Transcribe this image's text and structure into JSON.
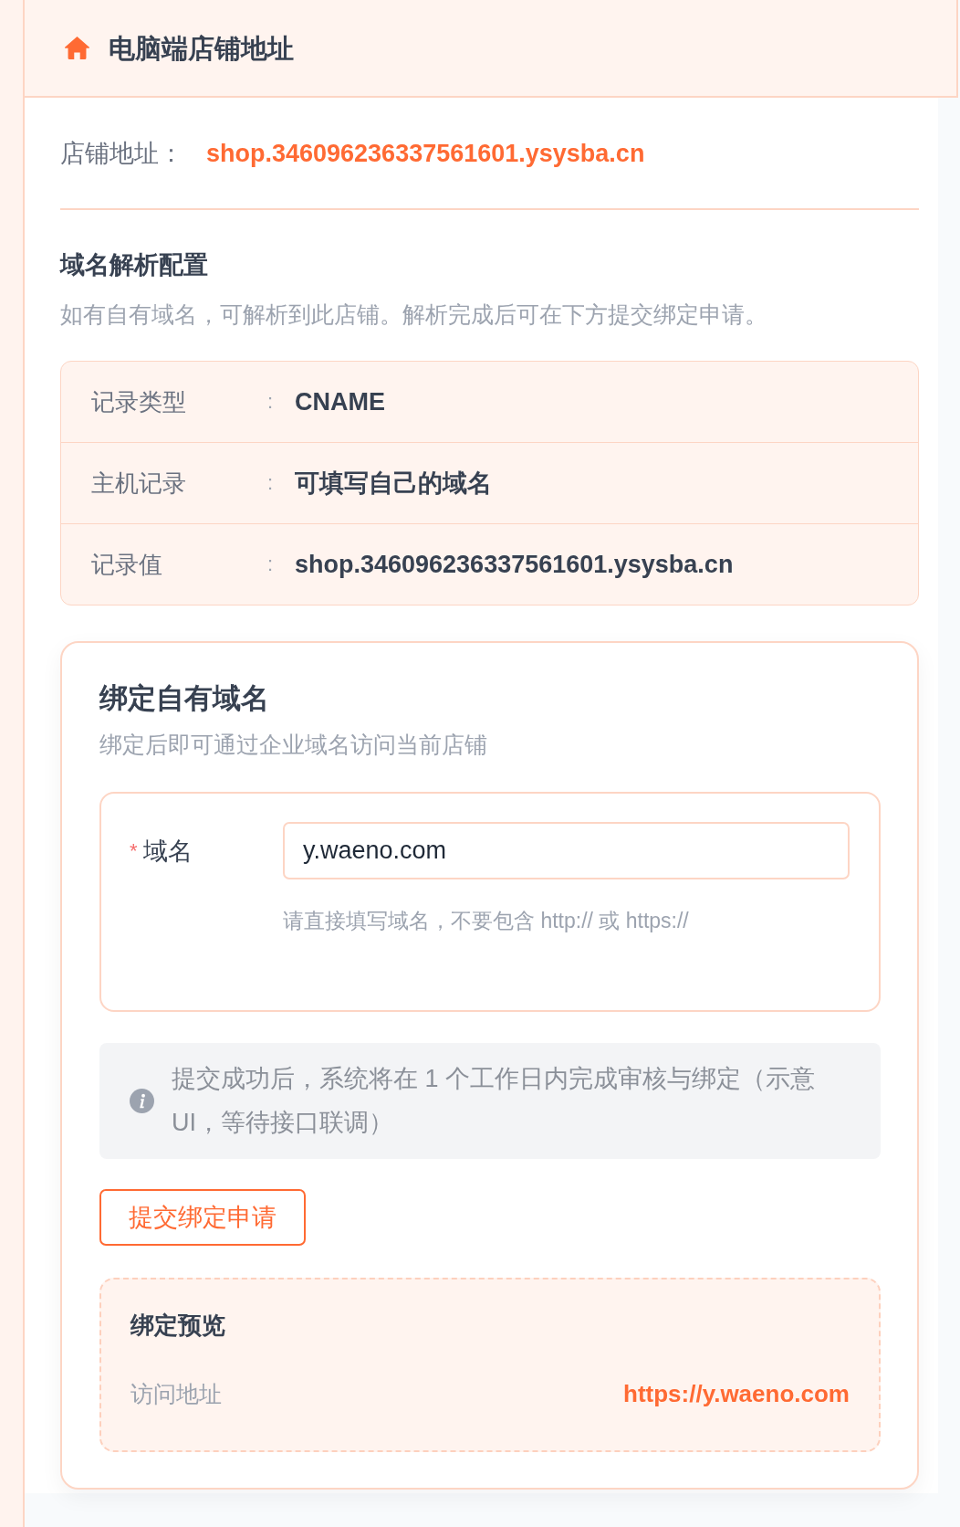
{
  "header": {
    "title": "电脑端店铺地址"
  },
  "shop_address": {
    "label": "店铺地址：",
    "url": "shop.346096236337561601.ysysba.cn"
  },
  "dns_config": {
    "title": "域名解析配置",
    "description": "如有自有域名，可解析到此店铺。解析完成后可在下方提交绑定申请。",
    "records": [
      {
        "label": "记录类型",
        "separator": ":",
        "value": "CNAME"
      },
      {
        "label": "主机记录",
        "separator": ":",
        "value": "可填写自己的域名"
      },
      {
        "label": "记录值",
        "separator": ":",
        "value": "shop.346096236337561601.ysysba.cn"
      }
    ]
  },
  "bind_domain": {
    "title": "绑定自有域名",
    "subtitle": "绑定后即可通过企业域名访问当前店铺",
    "field": {
      "required_mark": "*",
      "label": "域名",
      "value": "y.waeno.com",
      "hint": "请直接填写域名，不要包含 http:// 或 https://"
    },
    "notice": "提交成功后，系统将在 1 个工作日内完成审核与绑定（示意UI，等待接口联调）",
    "submit_button": "提交绑定申请",
    "preview": {
      "title": "绑定预览",
      "label": "访问地址",
      "url": "https://y.waeno.com"
    }
  }
}
